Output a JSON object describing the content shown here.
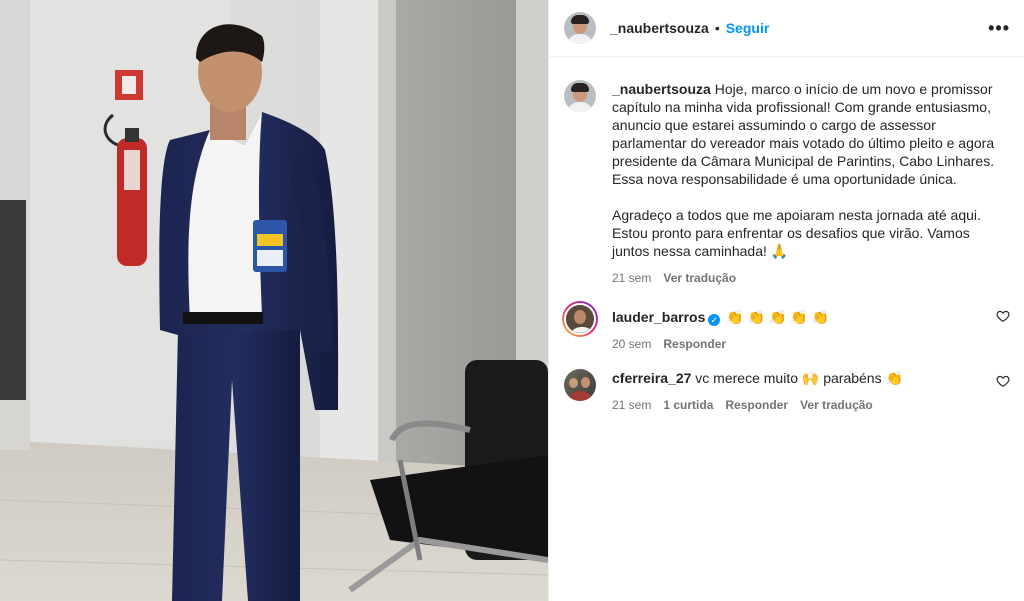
{
  "post": {
    "username": "_naubertsouza",
    "follow_label": "Seguir",
    "more_label": "•••"
  },
  "caption": {
    "username": "_naubertsouza",
    "paragraph1": "Hoje, marco o início de um novo e promissor capítulo na minha vida profissional! Com grande entusiasmo, anuncio que estarei assumindo o cargo de assessor parlamentar do vereador mais votado do último pleito e agora presidente da Câmara Municipal de Parintins, Cabo Linhares. Essa nova responsabilidade é uma oportunidade única.",
    "paragraph2": "Agradeço a todos que me apoiaram nesta jornada até aqui. Estou pronto para enfrentar os desafios que virão. Vamos juntos nessa caminhada! 🙏",
    "time": "21 sem",
    "translate": "Ver tradução"
  },
  "comments": [
    {
      "username": "lauder_barros",
      "verified": true,
      "text": "👏 👏 👏 👏 👏",
      "time": "20 sem",
      "reply": "Responder"
    },
    {
      "username": "cferreira_27",
      "text": "vc merece muito 🙌 parabéns 👏",
      "time": "21 sem",
      "likes": "1 curtida",
      "reply": "Responder",
      "translate": "Ver tradução"
    }
  ],
  "icons": {
    "more": "more-icon",
    "verified": "verified-badge-icon",
    "like": "heart-icon"
  },
  "colors": {
    "accent": "#0095f6",
    "text": "#262626",
    "muted": "#737373"
  }
}
